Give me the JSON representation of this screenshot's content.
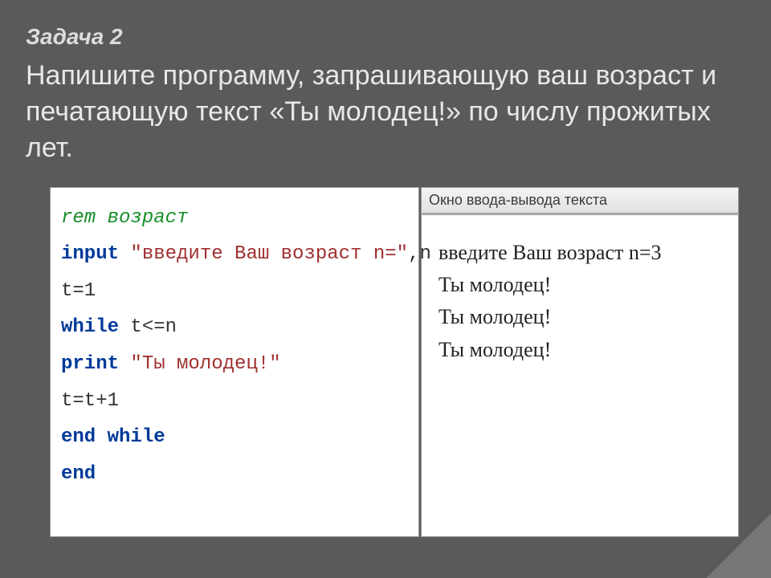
{
  "header": {
    "task_label": "Задача 2",
    "task_text": "Напишите программу, запрашивающую ваш возраст и печатающую текст «Ты молодец!» по числу прожитых лет."
  },
  "code": {
    "lines": [
      {
        "segments": [
          {
            "cls": "rem",
            "text": "rem возраст"
          }
        ]
      },
      {
        "segments": [
          {
            "cls": "kw",
            "text": "input "
          },
          {
            "cls": "str",
            "text": "\"введите Ваш возраст n=\""
          },
          {
            "cls": "plain",
            "text": ",n"
          }
        ]
      },
      {
        "segments": [
          {
            "cls": "plain",
            "text": "t=1"
          }
        ]
      },
      {
        "segments": [
          {
            "cls": "kw",
            "text": "while "
          },
          {
            "cls": "plain",
            "text": "t<=n"
          }
        ]
      },
      {
        "segments": [
          {
            "cls": "kw",
            "text": "print "
          },
          {
            "cls": "str",
            "text": "\"Ты молодец!\""
          }
        ]
      },
      {
        "segments": [
          {
            "cls": "plain",
            "text": "t=t+1"
          }
        ]
      },
      {
        "segments": [
          {
            "cls": "kw",
            "text": "end while"
          }
        ]
      },
      {
        "segments": [
          {
            "cls": "kw",
            "text": "end"
          }
        ]
      }
    ]
  },
  "output_window": {
    "title": "Окно ввода-вывода текста",
    "lines": [
      "введите Ваш возраст n=3",
      "Ты молодец!",
      "Ты молодец!",
      "Ты молодец!"
    ]
  }
}
